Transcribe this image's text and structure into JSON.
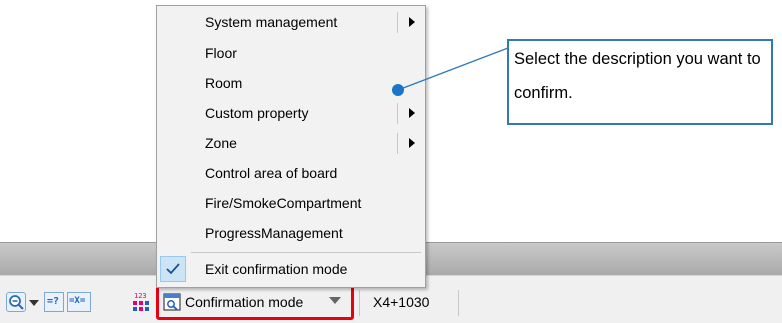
{
  "context_menu": {
    "items": [
      {
        "label": "System management",
        "submenu": true
      },
      {
        "label": "Floor",
        "submenu": false
      },
      {
        "label": "Room",
        "submenu": false
      },
      {
        "label": "Custom property",
        "submenu": true
      },
      {
        "label": "Zone",
        "submenu": true
      },
      {
        "label": "Control area of board",
        "submenu": false
      },
      {
        "label": "Fire/SmokeCompartment",
        "submenu": false
      },
      {
        "label": "ProgressManagement",
        "submenu": false
      }
    ],
    "exit_item": {
      "label": "Exit confirmation mode",
      "checked": true
    }
  },
  "callout": {
    "text": "Select the description you want to confirm."
  },
  "toolbar": {
    "zoom_icon": "zoom-icon",
    "query_icon_text": "=?",
    "clear_icon_text": "=X=",
    "numbering_icon_text": "123",
    "confirmation_mode": {
      "label": "Confirmation mode",
      "icon": "confirmation-mode-icon"
    },
    "coordinate": "X4+1030"
  },
  "colors": {
    "highlight_border": "#e60012",
    "callout_border": "#2f79b7",
    "leader_dot": "#1a75c9",
    "check_bg": "#cce4f7"
  }
}
